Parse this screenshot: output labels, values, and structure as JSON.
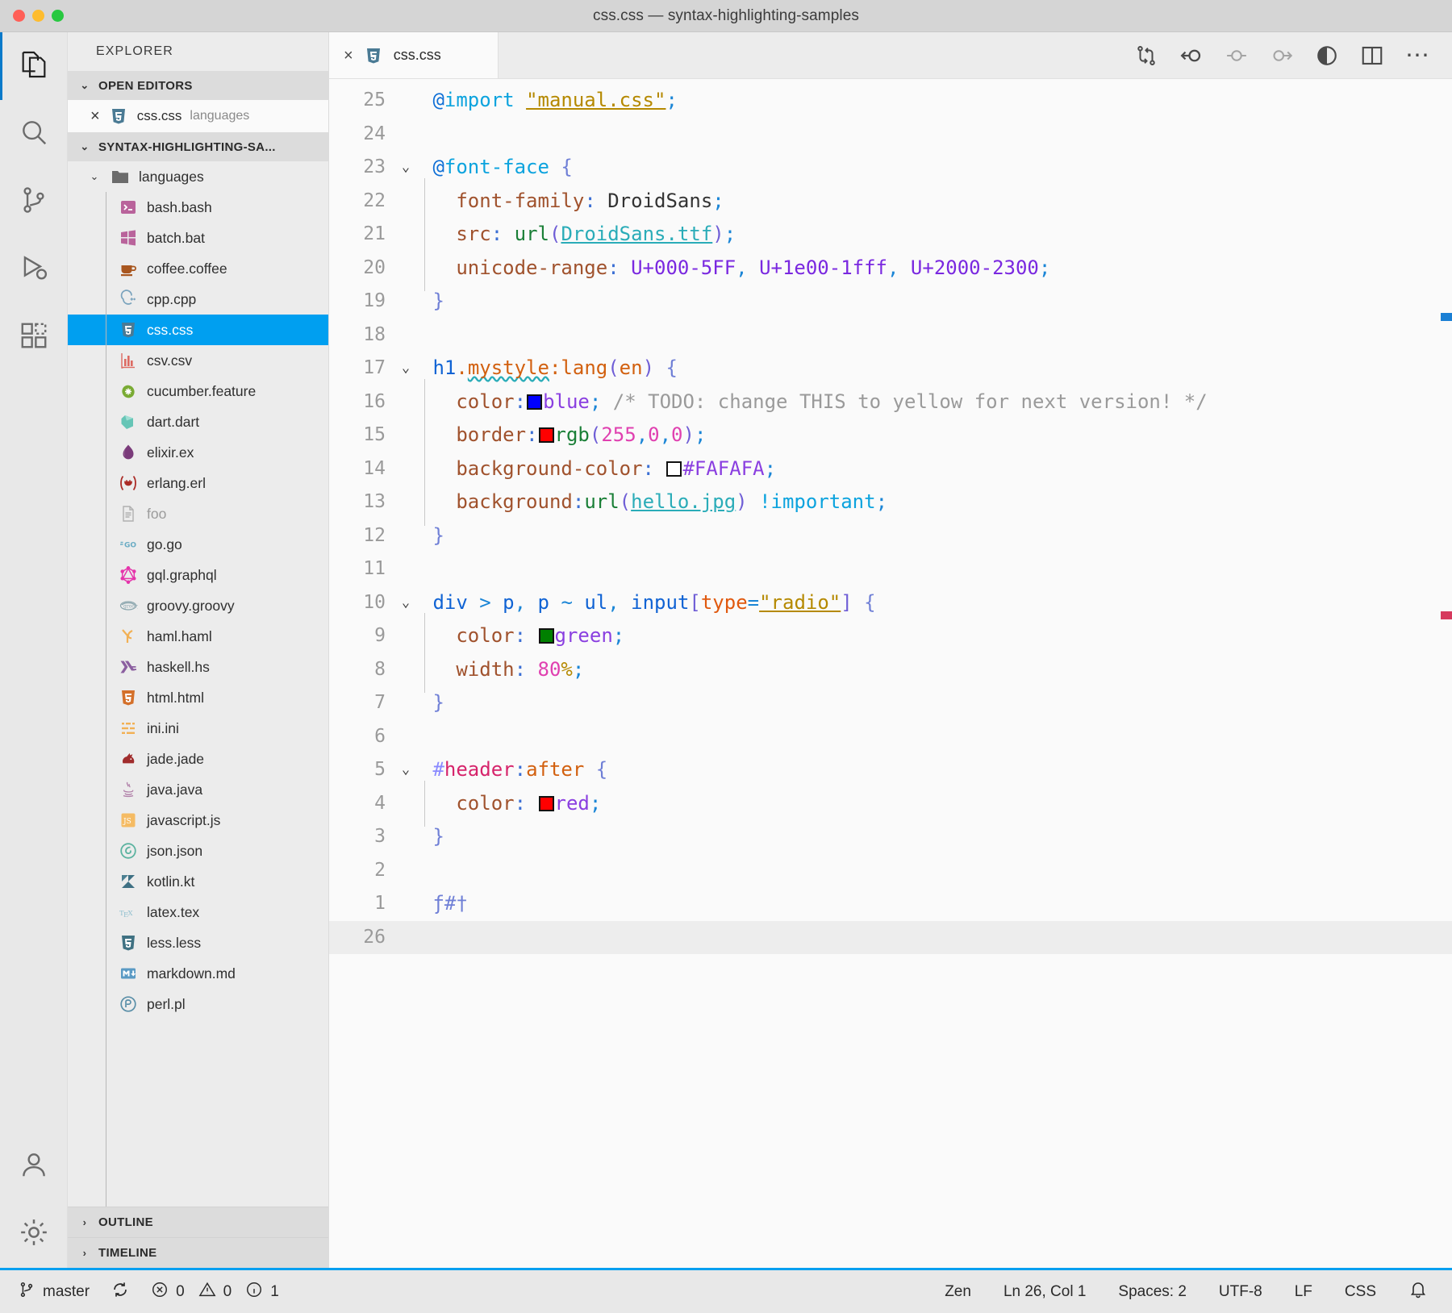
{
  "window": {
    "title": "css.css — syntax-highlighting-samples",
    "traffic_lights": [
      "close",
      "minimize",
      "maximize"
    ]
  },
  "activity_bar": {
    "items": [
      {
        "name": "explorer",
        "icon": "files-icon",
        "active": true
      },
      {
        "name": "search",
        "icon": "search-icon",
        "active": false
      },
      {
        "name": "source-control",
        "icon": "source-control-icon",
        "active": false
      },
      {
        "name": "run-and-debug",
        "icon": "run-debug-icon",
        "active": false
      },
      {
        "name": "extensions",
        "icon": "extensions-icon",
        "active": false
      }
    ],
    "bottom_items": [
      {
        "name": "accounts",
        "icon": "account-icon"
      },
      {
        "name": "manage",
        "icon": "gear-icon"
      }
    ]
  },
  "sidebar": {
    "title": "EXPLORER",
    "open_editors": {
      "header": "OPEN EDITORS",
      "expanded": true,
      "items": [
        {
          "name": "css.css",
          "folder": "languages",
          "icon": "css-icon",
          "close": "×"
        }
      ]
    },
    "workspace": {
      "header": "SYNTAX-HIGHLIGHTING-SA...",
      "expanded": true,
      "folder": {
        "label": "languages",
        "icon": "folder-icon",
        "expanded": true
      },
      "files": [
        {
          "label": "bash.bash",
          "icon": "bash-icon",
          "selected": false,
          "dim": false
        },
        {
          "label": "batch.bat",
          "icon": "batch-icon",
          "selected": false,
          "dim": false
        },
        {
          "label": "coffee.coffee",
          "icon": "coffee-icon",
          "selected": false,
          "dim": false
        },
        {
          "label": "cpp.cpp",
          "icon": "cpp-icon",
          "selected": false,
          "dim": false
        },
        {
          "label": "css.css",
          "icon": "css-icon",
          "selected": true,
          "dim": false
        },
        {
          "label": "csv.csv",
          "icon": "csv-icon",
          "selected": false,
          "dim": false
        },
        {
          "label": "cucumber.feature",
          "icon": "cucumber-icon",
          "selected": false,
          "dim": false
        },
        {
          "label": "dart.dart",
          "icon": "dart-icon",
          "selected": false,
          "dim": false
        },
        {
          "label": "elixir.ex",
          "icon": "elixir-icon",
          "selected": false,
          "dim": false
        },
        {
          "label": "erlang.erl",
          "icon": "erlang-icon",
          "selected": false,
          "dim": false
        },
        {
          "label": "foo",
          "icon": "file-icon",
          "selected": false,
          "dim": true
        },
        {
          "label": "go.go",
          "icon": "go-icon",
          "selected": false,
          "dim": false
        },
        {
          "label": "gql.graphql",
          "icon": "graphql-icon",
          "selected": false,
          "dim": false
        },
        {
          "label": "groovy.groovy",
          "icon": "groovy-icon",
          "selected": false,
          "dim": false
        },
        {
          "label": "haml.haml",
          "icon": "haml-icon",
          "selected": false,
          "dim": false
        },
        {
          "label": "haskell.hs",
          "icon": "haskell-icon",
          "selected": false,
          "dim": false
        },
        {
          "label": "html.html",
          "icon": "html-icon",
          "selected": false,
          "dim": false
        },
        {
          "label": "ini.ini",
          "icon": "ini-icon",
          "selected": false,
          "dim": false
        },
        {
          "label": "jade.jade",
          "icon": "jade-icon",
          "selected": false,
          "dim": false
        },
        {
          "label": "java.java",
          "icon": "java-icon",
          "selected": false,
          "dim": false
        },
        {
          "label": "javascript.js",
          "icon": "javascript-icon",
          "selected": false,
          "dim": false
        },
        {
          "label": "json.json",
          "icon": "json-icon",
          "selected": false,
          "dim": false
        },
        {
          "label": "kotlin.kt",
          "icon": "kotlin-icon",
          "selected": false,
          "dim": false
        },
        {
          "label": "latex.tex",
          "icon": "latex-icon",
          "selected": false,
          "dim": false
        },
        {
          "label": "less.less",
          "icon": "less-icon",
          "selected": false,
          "dim": false
        },
        {
          "label": "markdown.md",
          "icon": "markdown-icon",
          "selected": false,
          "dim": false
        },
        {
          "label": "perl.pl",
          "icon": "perl-icon",
          "selected": false,
          "dim": false
        }
      ]
    },
    "outline": {
      "header": "OUTLINE",
      "expanded": false
    },
    "timeline": {
      "header": "TIMELINE",
      "expanded": false
    }
  },
  "editor": {
    "tab": {
      "label": "css.css",
      "icon": "css-icon",
      "close": "×",
      "active": true
    },
    "actions": [
      {
        "name": "compare-changes",
        "icon": "git-compare-icon",
        "muted": false
      },
      {
        "name": "merge-accept-incoming",
        "icon": "arrow-circle-left-icon",
        "muted": false
      },
      {
        "name": "merge-marker",
        "icon": "circle-line-icon",
        "muted": true
      },
      {
        "name": "merge-accept-current",
        "icon": "circle-arrow-right-icon",
        "muted": true
      },
      {
        "name": "open-changes",
        "icon": "half-circle-icon",
        "muted": false
      },
      {
        "name": "split-editor",
        "icon": "split-editor-icon",
        "muted": false
      },
      {
        "name": "more-actions",
        "icon": "ellipsis-icon",
        "muted": false
      }
    ],
    "current_line": 26,
    "lines": [
      {
        "n": 25,
        "fold": "",
        "indent": false
      },
      {
        "n": 24,
        "fold": "",
        "indent": false
      },
      {
        "n": 23,
        "fold": "v",
        "indent": false
      },
      {
        "n": 22,
        "fold": "",
        "indent": true
      },
      {
        "n": 21,
        "fold": "",
        "indent": true
      },
      {
        "n": 20,
        "fold": "",
        "indent": true
      },
      {
        "n": 19,
        "fold": "",
        "indent": false
      },
      {
        "n": 18,
        "fold": "",
        "indent": false
      },
      {
        "n": 17,
        "fold": "v",
        "indent": false
      },
      {
        "n": 16,
        "fold": "",
        "indent": true
      },
      {
        "n": 15,
        "fold": "",
        "indent": true
      },
      {
        "n": 14,
        "fold": "",
        "indent": true
      },
      {
        "n": 13,
        "fold": "",
        "indent": true
      },
      {
        "n": 12,
        "fold": "",
        "indent": false
      },
      {
        "n": 11,
        "fold": "",
        "indent": false
      },
      {
        "n": 10,
        "fold": "v",
        "indent": false
      },
      {
        "n": 9,
        "fold": "",
        "indent": true
      },
      {
        "n": 8,
        "fold": "",
        "indent": true
      },
      {
        "n": 7,
        "fold": "",
        "indent": false
      },
      {
        "n": 6,
        "fold": "",
        "indent": false
      },
      {
        "n": 5,
        "fold": "v",
        "indent": false
      },
      {
        "n": 4,
        "fold": "",
        "indent": true
      },
      {
        "n": 3,
        "fold": "",
        "indent": false
      },
      {
        "n": 2,
        "fold": "",
        "indent": false
      },
      {
        "n": 1,
        "fold": "",
        "indent": false
      },
      {
        "n": 26,
        "fold": "",
        "indent": false
      }
    ],
    "source_text": [
      "@import \"manual.css\";",
      "",
      "@font-face {",
      "  font-family: DroidSans;",
      "  src: url(DroidSans.ttf);",
      "  unicode-range: U+000-5FF, U+1e00-1fff, U+2000-2300;",
      "}",
      "",
      "h1.mystyle:lang(en) {",
      "  color:■blue; /* TODO: change THIS to yellow for next version! */",
      "  border:■rgb(255,0,0);",
      "  background-color: ■#FAFAFA;",
      "  background:url(hello.jpg) !important;",
      "}",
      "",
      "div > p, p ~ ul, input[type=\"radio\"] {",
      "  color: ■green;",
      "  width: 80%;",
      "}",
      "",
      "#header:after {",
      "  color: ■red;",
      "}",
      "",
      "ƒ#†",
      ""
    ],
    "swatches": {
      "blue": "#0000ff",
      "red": "#ff0000",
      "white": "#ffffff",
      "green": "#008000"
    }
  },
  "status_bar": {
    "branch": "master",
    "sync_icon": "sync-icon",
    "errors": "0",
    "warnings": "0",
    "infos": "1",
    "error_icon": "error-circle-icon",
    "warning_icon": "warning-triangle-icon",
    "info_icon": "info-circle-icon",
    "zen": "Zen",
    "cursor": "Ln 26, Col 1",
    "indentation": "Spaces: 2",
    "encoding": "UTF-8",
    "eol": "LF",
    "language": "CSS",
    "bell_icon": "bell-icon",
    "accent": "#009ff0"
  }
}
